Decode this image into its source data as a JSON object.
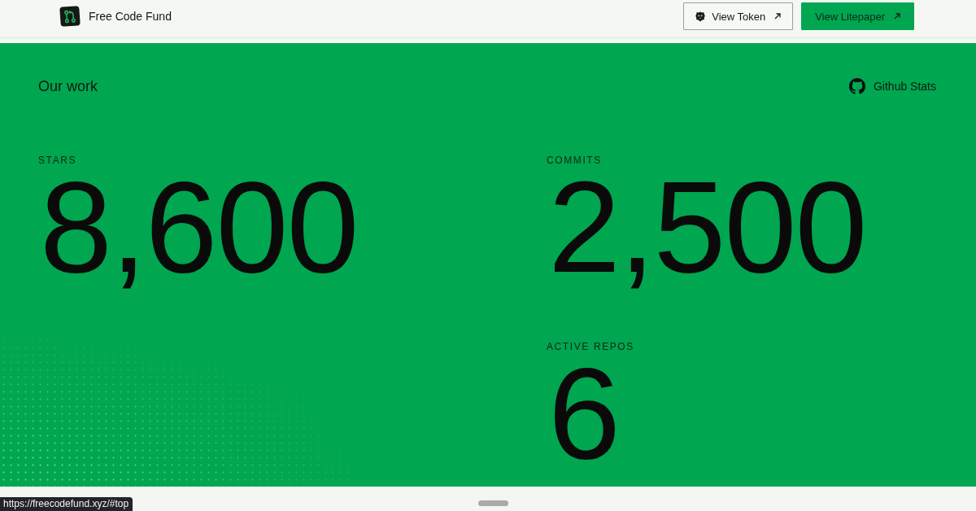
{
  "header": {
    "brand": "Free Code Fund",
    "buttons": [
      {
        "label": "View Token",
        "kind": "outline"
      },
      {
        "label": "View Litepaper",
        "kind": "filled"
      }
    ]
  },
  "section": {
    "title": "Our work",
    "link": "Github Stats",
    "columns": [
      {
        "stats": [
          {
            "label": "STARS",
            "value": "8,600"
          }
        ]
      },
      {
        "stats": [
          {
            "label": "COMMITS",
            "value": "2,500"
          },
          {
            "label": "ACTIVE REPOS",
            "value": "6"
          }
        ]
      }
    ]
  },
  "status_url": "https://freecodefund.xyz/#top"
}
